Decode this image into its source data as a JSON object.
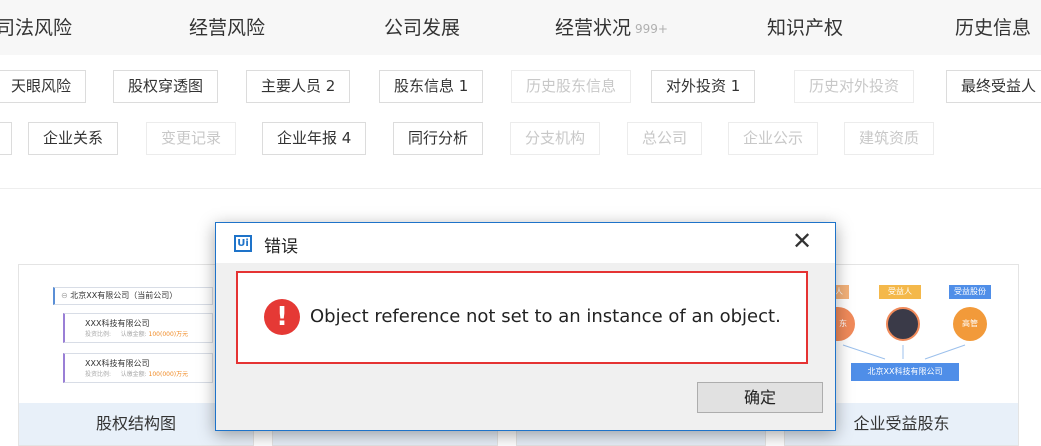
{
  "nav": {
    "items": [
      {
        "label": "司法风险"
      },
      {
        "label": "经营风险"
      },
      {
        "label": "公司发展"
      },
      {
        "label": "经营状况",
        "badge": "999+"
      },
      {
        "label": "知识产权"
      },
      {
        "label": "历史信息"
      }
    ]
  },
  "tags_row1": [
    {
      "label": "天眼风险"
    },
    {
      "label": "股权穿透图"
    },
    {
      "label": "主要人员 2"
    },
    {
      "label": "股东信息 1"
    },
    {
      "label": "历史股东信息"
    },
    {
      "label": "对外投资 1"
    },
    {
      "label": "历史对外投资"
    },
    {
      "label": "最终受益人"
    }
  ],
  "tags_row2": [
    {
      "label": "企业关系"
    },
    {
      "label": "变更记录"
    },
    {
      "label": "企业年报 4"
    },
    {
      "label": "同行分析"
    },
    {
      "label": "分支机构"
    },
    {
      "label": "总公司"
    },
    {
      "label": "企业公示"
    },
    {
      "label": "建筑资质"
    }
  ],
  "cards": {
    "equity": {
      "caption": "股权结构图",
      "root": "北京XX有限公司（当前公司）",
      "child1": "XXX科技有限公司",
      "child2": "XXX科技有限公司",
      "sub_label1": "投资比例:",
      "sub_label2": "认缴金额:",
      "sub_value": "100(000)万元",
      "expand": "⊖"
    },
    "beneficiary": {
      "caption": "企业受益股东",
      "chip1": "人",
      "chip2": "受益人",
      "chip3": "受益股份",
      "circle_left": "东",
      "circle_right": "高管",
      "company": "北京XX科技有限公司"
    }
  },
  "dialog": {
    "logo": "Ui",
    "title": "错误",
    "close_glyph": "✕",
    "message": "Object reference not set to an instance of an object.",
    "icon_glyph": "!",
    "ok_label": "确定"
  }
}
